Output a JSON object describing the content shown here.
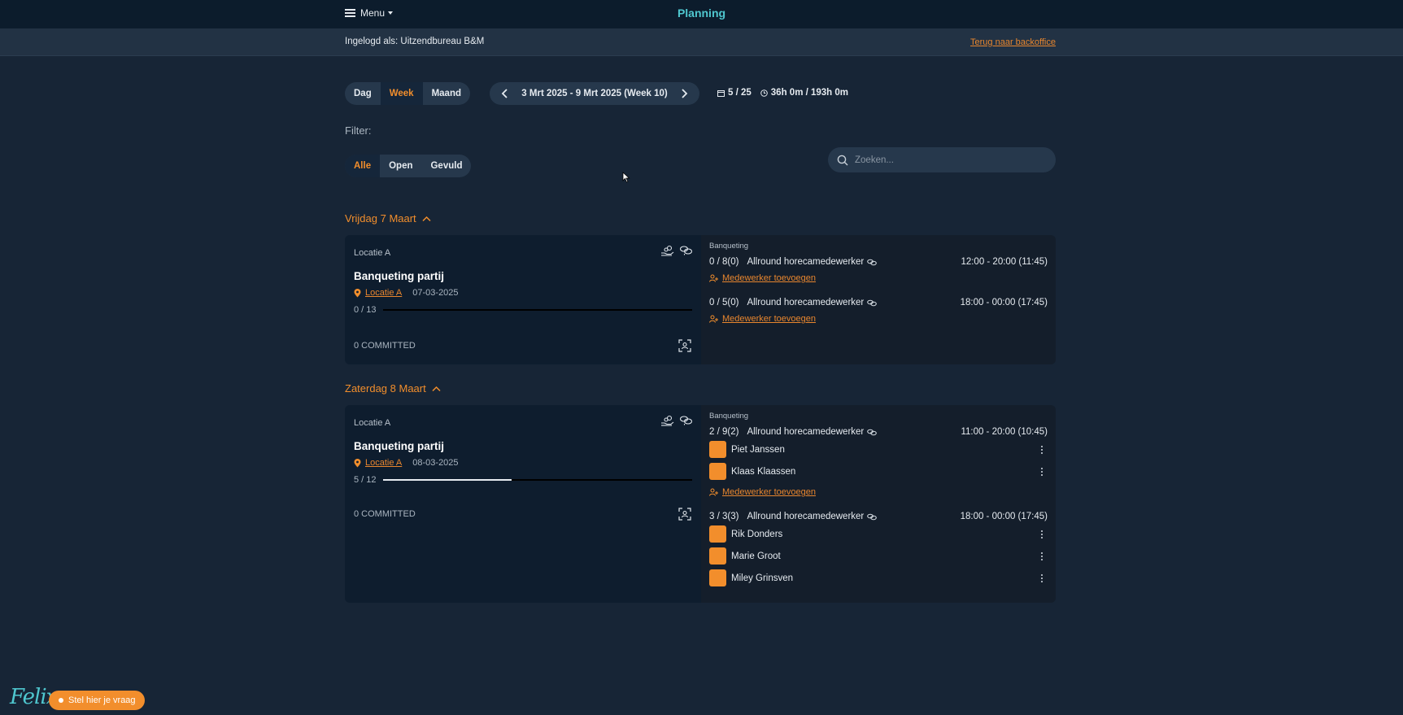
{
  "header": {
    "menu_label": "Menu",
    "title": "Planning"
  },
  "login": {
    "text": "Ingelogd als: Uitzendbureau B&M",
    "backoffice_link": "Terug naar backoffice"
  },
  "view_toggle": {
    "items": [
      "Dag",
      "Week",
      "Maand"
    ],
    "active": "Week"
  },
  "date_nav": {
    "label": "3 Mrt 2025 - 9 Mrt 2025 (Week 10)"
  },
  "stats": {
    "shifts": "5 / 25",
    "hours": "36h 0m / 193h 0m"
  },
  "filter": {
    "label": "Filter:",
    "items": [
      "Alle",
      "Open",
      "Gevuld"
    ],
    "active": "Alle"
  },
  "search": {
    "placeholder": "Zoeken..."
  },
  "days": [
    {
      "header": "Vrijdag 7 Maart",
      "location_small": "Locatie A",
      "event_title": "Banqueting partij",
      "location_link": "Locatie A",
      "date": "07-03-2025",
      "progress_text": "0 / 13",
      "progress_fraction": 0,
      "committed": "0 COMMITTED",
      "category": "Banqueting",
      "shifts": [
        {
          "count": "0 /  8(0)",
          "role": "Allround horecamedewerker",
          "time": "12:00 - 20:00 (11:45)",
          "workers": [],
          "add_label": "Medewerker toevoegen"
        },
        {
          "count": "0 /  5(0)",
          "role": "Allround horecamedewerker",
          "time": "18:00 - 00:00 (17:45)",
          "workers": [],
          "add_label": "Medewerker toevoegen"
        }
      ]
    },
    {
      "header": "Zaterdag 8 Maart",
      "location_small": "Locatie A",
      "event_title": "Banqueting partij",
      "location_link": "Locatie A",
      "date": "08-03-2025",
      "progress_text": "5 / 12",
      "progress_fraction": 0.4167,
      "committed": "0 COMMITTED",
      "category": "Banqueting",
      "shifts": [
        {
          "count": "2 /  9(2)",
          "role": "Allround horecamedewerker",
          "time": "11:00 - 20:00 (10:45)",
          "workers": [
            "Piet Janssen",
            "Klaas Klaassen"
          ],
          "add_label": "Medewerker toevoegen"
        },
        {
          "count": "3 /  3(3)",
          "role": "Allround horecamedewerker",
          "time": "18:00 - 00:00 (17:45)",
          "workers": [
            "Rik Donders",
            "Marie Groot",
            "Miley Grinsven"
          ],
          "add_label": ""
        }
      ]
    }
  ],
  "footer": {
    "logo_text": "Felix",
    "help_label": "Stel hier je vraag"
  },
  "colors": {
    "accent": "#f28e2c",
    "title": "#4fc7cf",
    "background": "#172536"
  }
}
